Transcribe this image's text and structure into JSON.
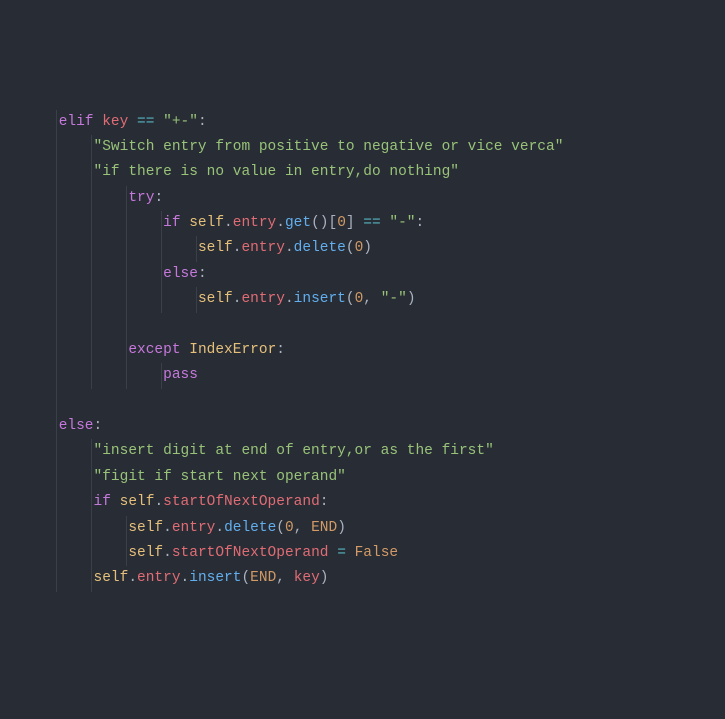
{
  "code": {
    "l1": {
      "kw1": "elif",
      "var": "key",
      "op": "==",
      "str": "\"+-\"",
      "p": ":"
    },
    "l2": {
      "str": "\"Switch entry from positive to negative or vice verca\""
    },
    "l3": {
      "str": "\"if there is no value in entry,do nothing\""
    },
    "l4": {
      "kw": "try",
      "p": ":"
    },
    "l5": {
      "kw": "if",
      "self": "self",
      "d1": ".",
      "attr1": "entry",
      "d2": ".",
      "fn": "get",
      "paren": "()[",
      "num": "0",
      "close": "]",
      "op": "==",
      "str": "\"-\"",
      "p": ":"
    },
    "l6": {
      "self": "self",
      "d1": ".",
      "attr1": "entry",
      "d2": ".",
      "fn": "delete",
      "open": "(",
      "num": "0",
      "close": ")"
    },
    "l7": {
      "kw": "else",
      "p": ":"
    },
    "l8": {
      "self": "self",
      "d1": ".",
      "attr1": "entry",
      "d2": ".",
      "fn": "insert",
      "open": "(",
      "num": "0",
      "comma": ", ",
      "str": "\"-\"",
      "close": ")"
    },
    "l9": {
      "kw": "except",
      "cls": "IndexError",
      "p": ":"
    },
    "l10": {
      "kw": "pass"
    },
    "l11": {
      "kw": "else",
      "p": ":"
    },
    "l12": {
      "str": "\"insert digit at end of entry,or as the first\""
    },
    "l13": {
      "str": "\"figit if start next operand\""
    },
    "l14": {
      "kw": "if",
      "self": "self",
      "d": ".",
      "attr": "startOfNextOperand",
      "p": ":"
    },
    "l15": {
      "self": "self",
      "d1": ".",
      "attr1": "entry",
      "d2": ".",
      "fn": "delete",
      "open": "(",
      "num": "0",
      "comma": ", ",
      "const": "END",
      "close": ")"
    },
    "l16": {
      "self": "self",
      "d1": ".",
      "attr": "startOfNextOperand",
      "op": "=",
      "const": "False"
    },
    "l17": {
      "self": "self",
      "d1": ".",
      "attr1": "entry",
      "d2": ".",
      "fn": "insert",
      "open": "(",
      "const": "END",
      "comma": ", ",
      "var": "key",
      "close": ")"
    }
  },
  "indent": {
    "guides": [
      56,
      91,
      126,
      161,
      196
    ]
  }
}
